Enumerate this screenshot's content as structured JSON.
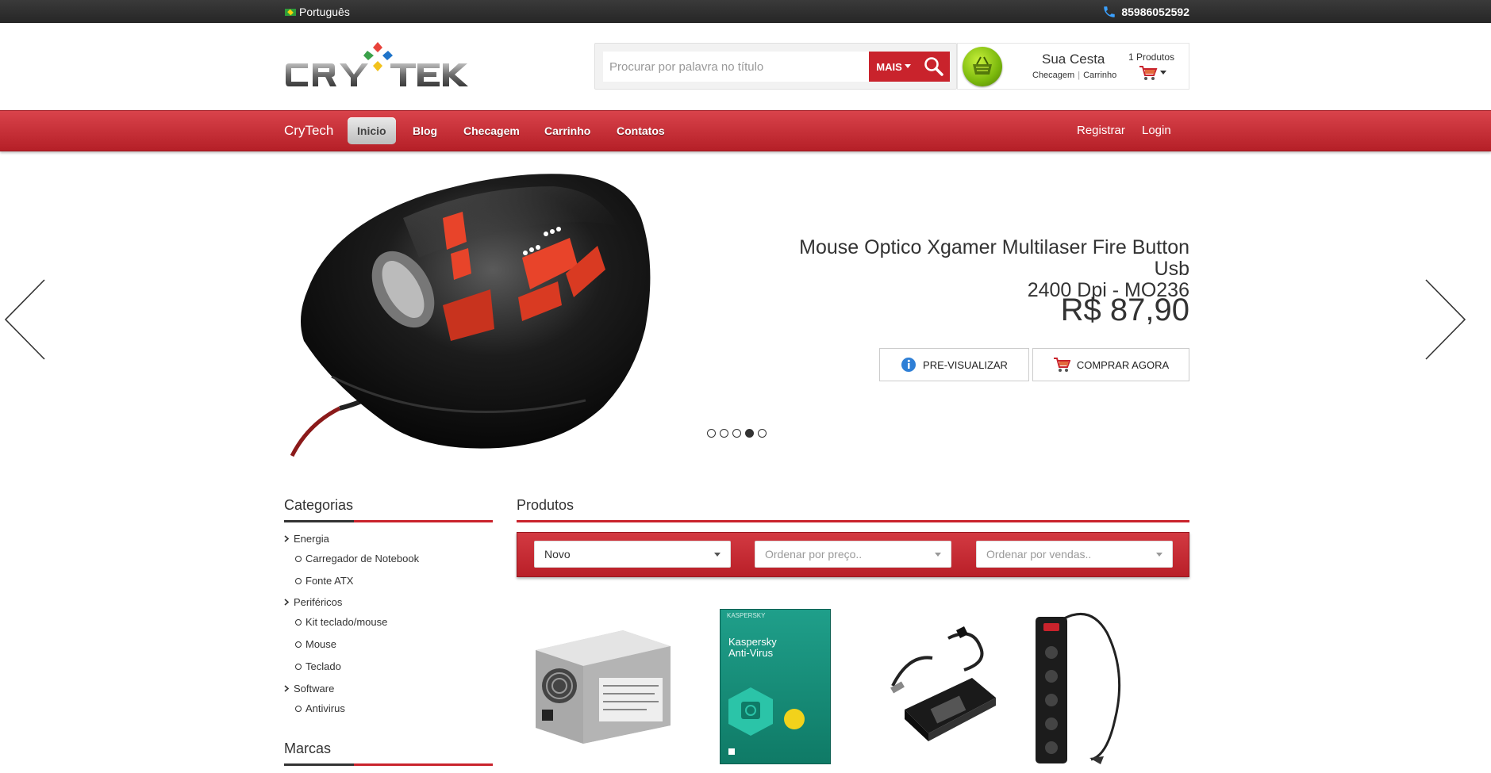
{
  "topbar": {
    "language": "Português",
    "phone": "85986052592"
  },
  "search": {
    "placeholder": "Procurar por palavra no título",
    "mais_label": "MAIS"
  },
  "cart": {
    "title": "Sua Cesta",
    "checkout_link": "Checagem",
    "cart_link": "Carrinho",
    "count": "1 Produtos"
  },
  "nav": {
    "brand": "CryTech",
    "items": [
      {
        "label": "Inicio"
      },
      {
        "label": "Blog"
      },
      {
        "label": "Checagem"
      },
      {
        "label": "Carrinho"
      },
      {
        "label": "Contatos"
      }
    ],
    "register": "Registrar",
    "login": "Login"
  },
  "slide": {
    "title_line1": "Mouse Optico Xgamer Multilaser Fire Button Usb",
    "title_line2": "2400 Dpi - MO236",
    "price": "R$ 87,90",
    "preview_label": "PRE-VISUALIZAR",
    "buy_label": "COMPRAR AGORA",
    "active_dot": 4
  },
  "sidebar": {
    "categories_title": "Categorias",
    "brands_title": "Marcas",
    "categories": [
      {
        "label": "Energia",
        "subs": [
          "Carregador de Notebook",
          "Fonte ATX"
        ]
      },
      {
        "label": "Periféricos",
        "subs": [
          "Kit teclado/mouse",
          "Mouse",
          "Teclado"
        ]
      },
      {
        "label": "Software",
        "subs": [
          "Antivirus"
        ]
      }
    ]
  },
  "products": {
    "title": "Produtos",
    "filters": {
      "sort_new": "Novo",
      "sort_price": "Ordenar por preço..",
      "sort_sales": "Ordenar por vendas.."
    },
    "kaspersky_brand": "KASPERSKY",
    "kaspersky_name_1": "Kaspersky",
    "kaspersky_name_2": "Anti-Virus"
  },
  "colors": {
    "accent": "#c9232c",
    "topbar": "#2b2b2b"
  }
}
